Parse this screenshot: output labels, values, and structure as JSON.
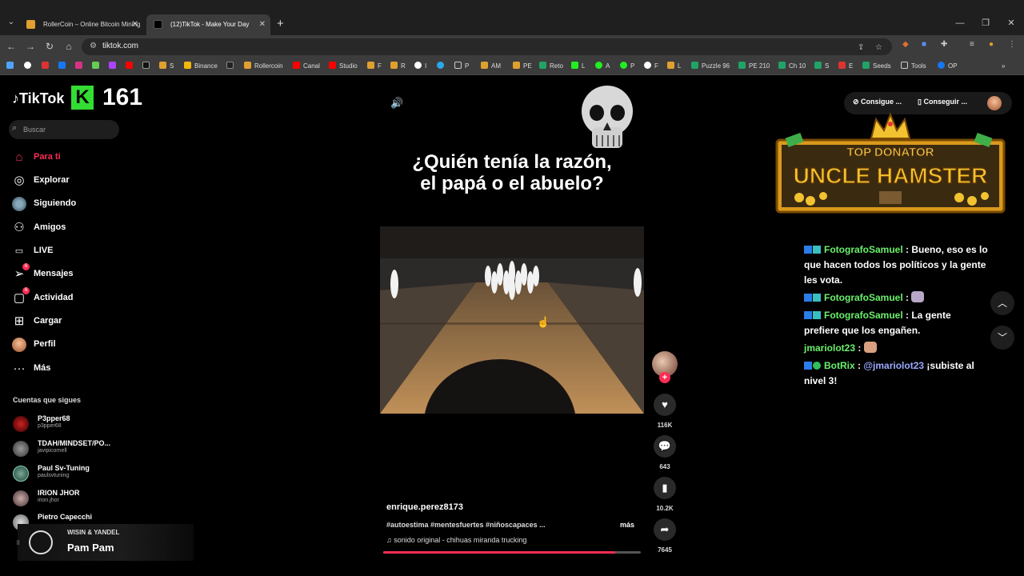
{
  "browser": {
    "tabs": [
      {
        "title": "RollerCoin – Online Bitcoin Mining",
        "active": false
      },
      {
        "title": "(12)TikTok - Make Your Day",
        "active": true
      }
    ],
    "url": "tiktok.com",
    "bookmarks": [
      "",
      "",
      "",
      "",
      "",
      "",
      "",
      "",
      "S",
      "Binance",
      "",
      "Rollercoin",
      "Canal",
      "Studio",
      "F",
      "R",
      "I",
      "",
      "P",
      "AM",
      "PE",
      "Reto",
      "L",
      "A",
      "P",
      "F",
      "L",
      "Puzzle 96",
      "PE 210",
      "Ch 10",
      "S",
      "E",
      "Seeds",
      "Tools",
      "OP"
    ]
  },
  "sidebar": {
    "logo": "TikTok",
    "k_letter": "K",
    "counter": "161",
    "search_placeholder": "Buscar",
    "menu": [
      {
        "label": "Para ti",
        "icon": "home-icon"
      },
      {
        "label": "Explorar",
        "icon": "compass-icon"
      },
      {
        "label": "Siguiendo",
        "icon": "following-avatar-icon"
      },
      {
        "label": "Amigos",
        "icon": "friends-icon"
      },
      {
        "label": "LIVE",
        "icon": "live-icon"
      },
      {
        "label": "Mensajes",
        "icon": "messages-icon",
        "badge": "6"
      },
      {
        "label": "Actividad",
        "icon": "activity-icon",
        "badge": "6"
      },
      {
        "label": "Cargar",
        "icon": "upload-icon"
      },
      {
        "label": "Perfil",
        "icon": "profile-avatar-icon"
      },
      {
        "label": "Más",
        "icon": "more-icon"
      }
    ],
    "following_title": "Cuentas que sigues",
    "following": [
      {
        "name": "P3pper68",
        "user": "p3pper68"
      },
      {
        "name": "TDAH/MINDSET/PO...",
        "user": "javipicornell"
      },
      {
        "name": "Paul Sv-Tuning",
        "user": "paulsvtuning"
      },
      {
        "name": "IRION JHOR",
        "user": "irion.jhor"
      },
      {
        "name": "Pietro Capecchi",
        "user": ""
      }
    ],
    "music": {
      "artist": "WISIN & YANDEL",
      "song": "Pam Pam"
    }
  },
  "video": {
    "caption_line1": "¿Quién tenía la razón,",
    "caption_line2": "el papá o el abuelo?",
    "author": "enrique.perez8173",
    "tags": "#autoestima #mentesfuertes #niñoscapaces ...",
    "more": "más",
    "sound": "sonido original - chihuas miranda trucking",
    "progress": 0.9
  },
  "actions": {
    "likes": "116K",
    "comments": "643",
    "saves": "10.2K",
    "shares": "7645"
  },
  "header_right": {
    "get_coins": "Consigue ...",
    "get_app": "Conseguir ..."
  },
  "overlay": {
    "banner_top": "TOP DONATOR",
    "banner_name": "UNCLE HAMSTER"
  },
  "chat": [
    {
      "user": "FotografoSamuel",
      "text": "Bueno, eso es lo que hacen todos los políticos y la gente les vota."
    },
    {
      "user": "FotografoSamuel",
      "text": ""
    },
    {
      "user": "FotografoSamuel",
      "text": "La gente prefiere que los engañen."
    },
    {
      "user": "jmariolot23",
      "text": ""
    },
    {
      "user": "BotRix",
      "mention": "@jmariolot23",
      "text": "¡subiste al nivel 3!"
    }
  ],
  "colors": {
    "accent": "#fe2c55",
    "chat_user": "#6bf06b",
    "banner_gold": "#f2c230"
  }
}
